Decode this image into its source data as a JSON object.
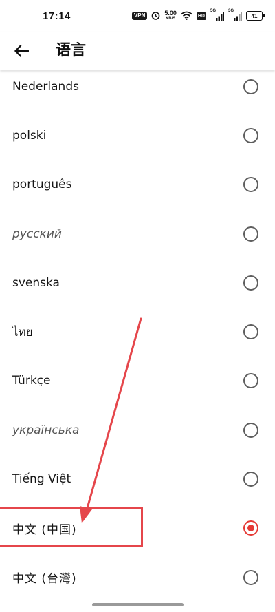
{
  "status_bar": {
    "time": "17:14",
    "vpn": "VPN",
    "speed_value": "5.00",
    "speed_unit": "KB/S",
    "hd": "HD",
    "sim1_tag": "5G",
    "sim2_tag": "3G",
    "battery": "41"
  },
  "header": {
    "title": "语言",
    "back_icon": "arrow-left-icon"
  },
  "languages": [
    {
      "label": "Nederlands",
      "selected": false
    },
    {
      "label": "polski",
      "selected": false
    },
    {
      "label": "português",
      "selected": false
    },
    {
      "label": "русский",
      "selected": false
    },
    {
      "label": "svenska",
      "selected": false
    },
    {
      "label": "ไทย",
      "selected": false
    },
    {
      "label": "Türkçe",
      "selected": false
    },
    {
      "label": "українська",
      "selected": false
    },
    {
      "label": "Tiếng Việt",
      "selected": false
    },
    {
      "label": "中文 (中国)",
      "selected": true
    },
    {
      "label": "中文 (台灣)",
      "selected": false
    }
  ],
  "colors": {
    "accent": "#e53935",
    "annotation": "#e5464b"
  }
}
